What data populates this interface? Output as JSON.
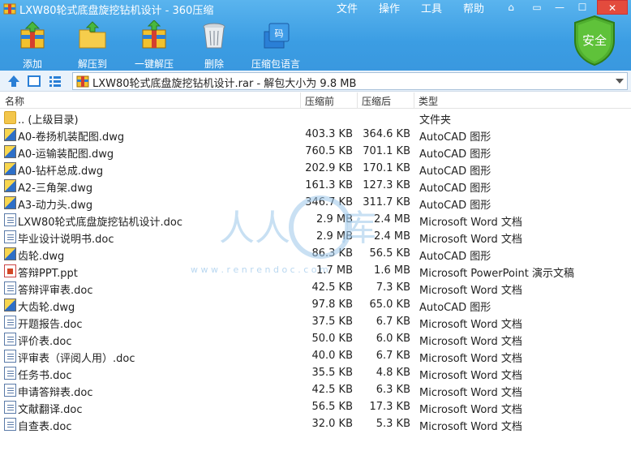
{
  "window": {
    "title": "LXW80轮式底盘旋挖钻机设计 - 360压缩"
  },
  "menu": [
    "文件",
    "操作",
    "工具",
    "帮助"
  ],
  "toolbar": {
    "add": "添加",
    "extract_to": "解压到",
    "one_click_extract": "一键解压",
    "delete": "删除",
    "archive_language": "压缩包语言",
    "language_badge": "码",
    "security": "安全"
  },
  "address": {
    "path": "LXW80轮式底盘旋挖钻机设计.rar - 解包大小为 9.8 MB"
  },
  "columns": {
    "name": "名称",
    "size": "压缩前",
    "compressed": "压缩后",
    "type": "类型"
  },
  "files": [
    {
      "name": ".. (上级目录)",
      "size": "",
      "compressed": "",
      "type": "文件夹",
      "icon": "folder"
    },
    {
      "name": "A0-卷扬机装配图.dwg",
      "size": "403.3 KB",
      "compressed": "364.6 KB",
      "type": "AutoCAD 图形",
      "icon": "dwg"
    },
    {
      "name": "A0-运输装配图.dwg",
      "size": "760.5 KB",
      "compressed": "701.1 KB",
      "type": "AutoCAD 图形",
      "icon": "dwg"
    },
    {
      "name": "A0-钻杆总成.dwg",
      "size": "202.9 KB",
      "compressed": "170.1 KB",
      "type": "AutoCAD 图形",
      "icon": "dwg"
    },
    {
      "name": "A2-三角架.dwg",
      "size": "161.3 KB",
      "compressed": "127.3 KB",
      "type": "AutoCAD 图形",
      "icon": "dwg"
    },
    {
      "name": "A3-动力头.dwg",
      "size": "346.7 KB",
      "compressed": "311.7 KB",
      "type": "AutoCAD 图形",
      "icon": "dwg"
    },
    {
      "name": "LXW80轮式底盘旋挖钻机设计.doc",
      "size": "2.9 MB",
      "compressed": "2.4 MB",
      "type": "Microsoft Word 文档",
      "icon": "doc"
    },
    {
      "name": "毕业设计说明书.doc",
      "size": "2.9 MB",
      "compressed": "2.4 MB",
      "type": "Microsoft Word 文档",
      "icon": "doc"
    },
    {
      "name": "齿轮.dwg",
      "size": "86.3 KB",
      "compressed": "56.5 KB",
      "type": "AutoCAD 图形",
      "icon": "dwg"
    },
    {
      "name": "答辩PPT.ppt",
      "size": "1.7 MB",
      "compressed": "1.6 MB",
      "type": "Microsoft PowerPoint 演示文稿",
      "icon": "ppt"
    },
    {
      "name": "答辩评审表.doc",
      "size": "42.5 KB",
      "compressed": "7.3 KB",
      "type": "Microsoft Word 文档",
      "icon": "doc"
    },
    {
      "name": "大齿轮.dwg",
      "size": "97.8 KB",
      "compressed": "65.0 KB",
      "type": "AutoCAD 图形",
      "icon": "dwg"
    },
    {
      "name": "开题报告.doc",
      "size": "37.5 KB",
      "compressed": "6.7 KB",
      "type": "Microsoft Word 文档",
      "icon": "doc"
    },
    {
      "name": "评价表.doc",
      "size": "50.0 KB",
      "compressed": "6.0 KB",
      "type": "Microsoft Word 文档",
      "icon": "doc"
    },
    {
      "name": "评审表（评阅人用）.doc",
      "size": "40.0 KB",
      "compressed": "6.7 KB",
      "type": "Microsoft Word 文档",
      "icon": "doc"
    },
    {
      "name": "任务书.doc",
      "size": "35.5 KB",
      "compressed": "4.8 KB",
      "type": "Microsoft Word 文档",
      "icon": "doc"
    },
    {
      "name": "申请答辩表.doc",
      "size": "42.5 KB",
      "compressed": "6.3 KB",
      "type": "Microsoft Word 文档",
      "icon": "doc"
    },
    {
      "name": "文献翻译.doc",
      "size": "56.5 KB",
      "compressed": "17.3 KB",
      "type": "Microsoft Word 文档",
      "icon": "doc"
    },
    {
      "name": "自查表.doc",
      "size": "32.0 KB",
      "compressed": "5.3 KB",
      "type": "Microsoft Word 文档",
      "icon": "doc"
    }
  ],
  "watermark": {
    "text": "人人文库",
    "url": "w w w . r e n r e n d o c . c o m"
  },
  "colors": {
    "toolbar_bg": "#3b9de3",
    "address_bg": "#e9f2fb",
    "security_green": "#4fae2f",
    "close_red": "#e34b3d"
  }
}
